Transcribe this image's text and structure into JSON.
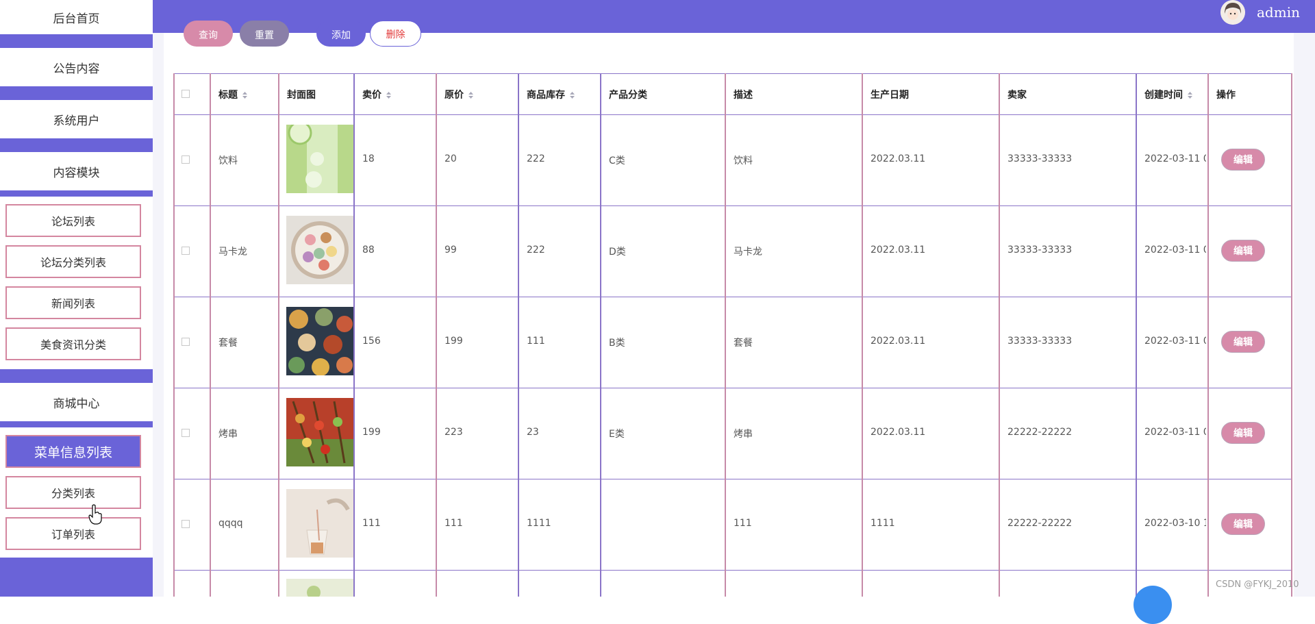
{
  "sidebar": {
    "main_items": [
      {
        "label": "后台首页"
      },
      {
        "label": "公告内容"
      },
      {
        "label": "系统用户"
      },
      {
        "label": "内容模块"
      },
      {
        "label": "商城中心"
      }
    ],
    "content_sub_items": [
      {
        "label": "论坛列表"
      },
      {
        "label": "论坛分类列表"
      },
      {
        "label": "新闻列表"
      },
      {
        "label": "美食资讯分类"
      }
    ],
    "mall_sub_items": [
      {
        "label": "菜单信息列表",
        "active": true
      },
      {
        "label": "分类列表"
      },
      {
        "label": "订单列表"
      }
    ]
  },
  "header": {
    "username": "admin"
  },
  "toolbar": {
    "query_label": "查询",
    "reset_label": "重置",
    "add_label": "添加",
    "delete_label": "删除"
  },
  "table": {
    "columns": [
      "标题",
      "封面图",
      "卖价",
      "原价",
      "商品库存",
      "产品分类",
      "描述",
      "生产日期",
      "卖家",
      "创建时间",
      "操作"
    ],
    "sortable": [
      "标题",
      "卖价",
      "原价",
      "商品库存",
      "创建时间"
    ],
    "edit_label": "编辑",
    "rows": [
      {
        "title": "饮料",
        "cover": "lime-drink",
        "price": "18",
        "original_price": "20",
        "stock": "222",
        "category": "C类",
        "description": "饮料",
        "production_date": "2022.03.11",
        "seller": "33333-33333",
        "created": "2022-03-11 0"
      },
      {
        "title": "马卡龙",
        "cover": "macarons",
        "price": "88",
        "original_price": "99",
        "stock": "222",
        "category": "D类",
        "description": "马卡龙",
        "production_date": "2022.03.11",
        "seller": "33333-33333",
        "created": "2022-03-11 0"
      },
      {
        "title": "套餐",
        "cover": "meal-set",
        "price": "156",
        "original_price": "199",
        "stock": "111",
        "category": "B类",
        "description": "套餐",
        "production_date": "2022.03.11",
        "seller": "33333-33333",
        "created": "2022-03-11 0"
      },
      {
        "title": "烤串",
        "cover": "skewers",
        "price": "199",
        "original_price": "223",
        "stock": "23",
        "category": "E类",
        "description": "烤串",
        "production_date": "2022.03.11",
        "seller": "22222-22222",
        "created": "2022-03-11 0"
      },
      {
        "title": "qqqq",
        "cover": "tea-cup",
        "price": "111",
        "original_price": "111",
        "stock": "1111",
        "category": "",
        "description": "111",
        "production_date": "1111",
        "seller": "22222-22222",
        "created": "2022-03-10 1"
      }
    ]
  },
  "watermark": "CSDN @FYKJ_2010",
  "colors": {
    "primary": "#6a63d8",
    "pink": "#d78aa9",
    "grid": "#8a74c8"
  }
}
